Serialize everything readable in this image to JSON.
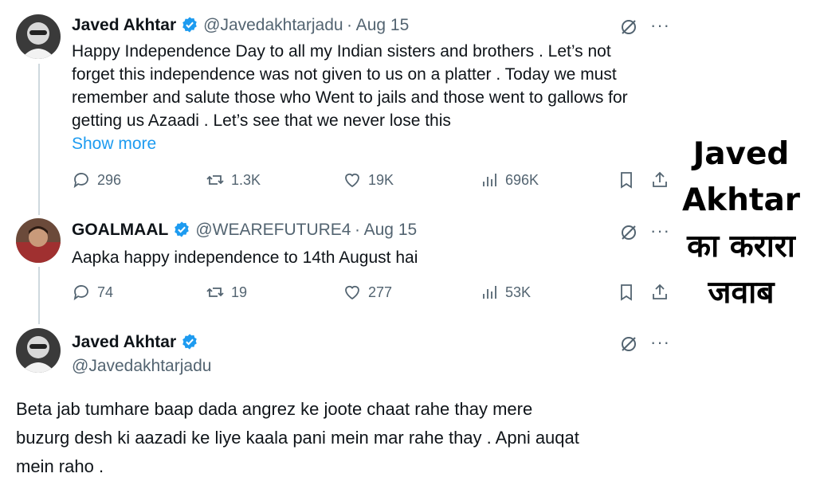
{
  "tweets": [
    {
      "name": "Javed Akhtar",
      "handle": "@Javedakhtarjadu",
      "date": "· Aug 15",
      "text_lines": [
        "Happy Independence Day  to all my Indian sisters and brothers  . Let’s not",
        "forget this independence was not given to us on a platter . Today we must",
        "remember and salute those who Went to jails and those went to gallows for",
        "getting us Azaadi . Let’s see that we never lose this"
      ],
      "show_more": "Show more",
      "replies": "296",
      "retweets": "1.3K",
      "likes": "19K",
      "views": "696K"
    },
    {
      "name": "GOALMAAL",
      "handle": "@WEAREFUTURE4",
      "date": "· Aug 15",
      "text": "Aapka happy independence to 14th August hai",
      "replies": "74",
      "retweets": "19",
      "likes": "277",
      "views": "53K"
    },
    {
      "name": "Javed Akhtar",
      "handle": "@Javedakhtarjadu",
      "text_lines": [
        "Beta jab tumhare baap dada angrez ke joote chaat rahe thay mere",
        "buzurg desh ki aazadi ke liye kaala pani mein mar rahe thay . Apni auqat",
        "mein raho ."
      ]
    }
  ],
  "caption_lines": [
    "Javed",
    "Akhtar",
    "का करारा",
    "जवाब"
  ],
  "more_glyph": "···",
  "colors": {
    "verified": "#1d9bf0",
    "link": "#1d9bf0",
    "muted": "#536471"
  },
  "icons": [
    "verified-badge-icon",
    "grok-icon",
    "more-icon",
    "reply-icon",
    "retweet-icon",
    "like-icon",
    "views-icon",
    "bookmark-icon",
    "share-icon"
  ]
}
